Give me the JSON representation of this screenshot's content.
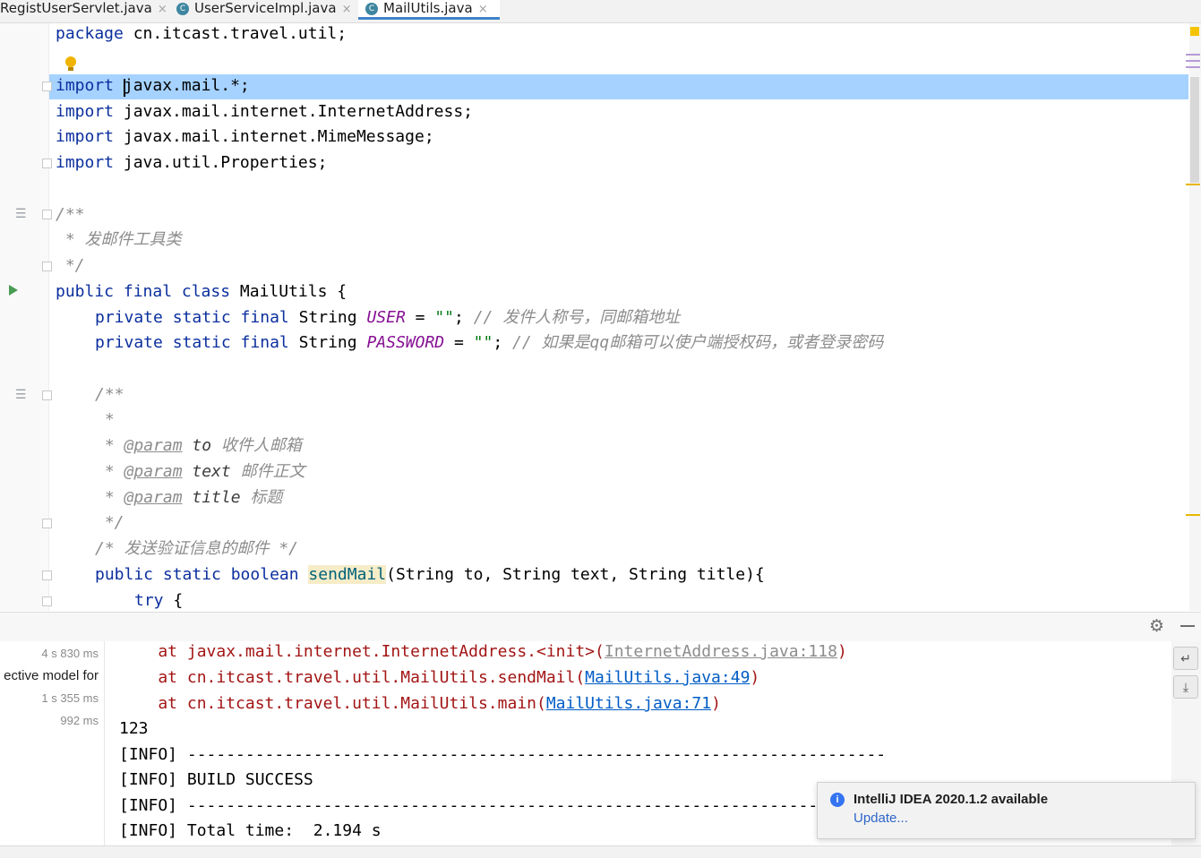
{
  "tabs": [
    {
      "label": "RegistUserServlet.java",
      "close": "×"
    },
    {
      "label": "UserServiceImpl.java",
      "close": "×",
      "icon": "C"
    },
    {
      "label": "MailUtils.java",
      "close": "×",
      "icon": "C",
      "active": true
    }
  ],
  "code": {
    "l1": {
      "kw": "package",
      "rest": " cn.itcast.travel.util;"
    },
    "l3": {
      "kw": "import",
      "a": " ",
      "b": "javax.mail.*;"
    },
    "l4": {
      "kw": "import",
      "rest": " javax.mail.internet.InternetAddress;"
    },
    "l5": {
      "kw": "import",
      "rest": " javax.mail.internet.MimeMessage;"
    },
    "l6": {
      "kw": "import",
      "rest": " java.util.Properties;"
    },
    "l8": "/**",
    "l9": " * 发邮件工具类",
    "l10": " */",
    "l11": {
      "kw": "public final class",
      "rest": " MailUtils {"
    },
    "l12": {
      "kw": "private static final",
      "type": " String ",
      "name": "USER",
      "eq": " = ",
      "str": "\"\"",
      "semi": "; ",
      "comment": "// 发件人称号，同邮箱地址"
    },
    "l13": {
      "kw": "private static final",
      "type": " String ",
      "name": "PASSWORD",
      "eq": " = ",
      "str": "\"\"",
      "semi": "; ",
      "comment": "// 如果是qq邮箱可以使户端授权码，或者登录密码"
    },
    "l15": "/**",
    "l16": " *",
    "l17": {
      "star": " * ",
      "tag": "@param",
      "p": " to",
      "desc": " 收件人邮箱"
    },
    "l18": {
      "star": " * ",
      "tag": "@param",
      "p": " text",
      "desc": " 邮件正文"
    },
    "l19": {
      "star": " * ",
      "tag": "@param",
      "p": " title",
      "desc": " 标题"
    },
    "l20": " */",
    "l21": "/* 发送验证信息的邮件 */",
    "l22": {
      "kw": "public static boolean",
      "sp": " ",
      "method": "sendMail",
      "rest": "(String to, String text, String title){"
    },
    "l23": {
      "kw": "try",
      "rest": " {"
    }
  },
  "run_list": [
    {
      "label": "4 s 830 ms"
    },
    {
      "label": "ective model for"
    },
    {
      "label": "1 s 355 ms"
    },
    {
      "label": "992 ms"
    }
  ],
  "console": {
    "c1": {
      "pre": "    at javax.mail.internet.InternetAddress.<init>(",
      "link": "InternetAddress.java:118",
      "post": ")"
    },
    "c2": {
      "pre": "    at cn.itcast.travel.util.MailUtils.sendMail(",
      "link": "MailUtils.java:49",
      "post": ")"
    },
    "c3": {
      "pre": "    at cn.itcast.travel.util.MailUtils.main(",
      "link": "MailUtils.java:71",
      "post": ")"
    },
    "c4": "123",
    "c5": "[INFO] ------------------------------------------------------------------------",
    "c6": "[INFO] BUILD SUCCESS",
    "c7": "[INFO] ------------------------------------------------------------------------",
    "c8": "[INFO] Total time:  2.194 s"
  },
  "notification": {
    "title": "IntelliJ IDEA 2020.1.2 available",
    "link": "Update..."
  },
  "icons": {
    "gear": "gear-icon",
    "minimize": "minimize-icon",
    "info": "info-icon",
    "bulb": "lightbulb-icon",
    "run": "run-icon"
  }
}
